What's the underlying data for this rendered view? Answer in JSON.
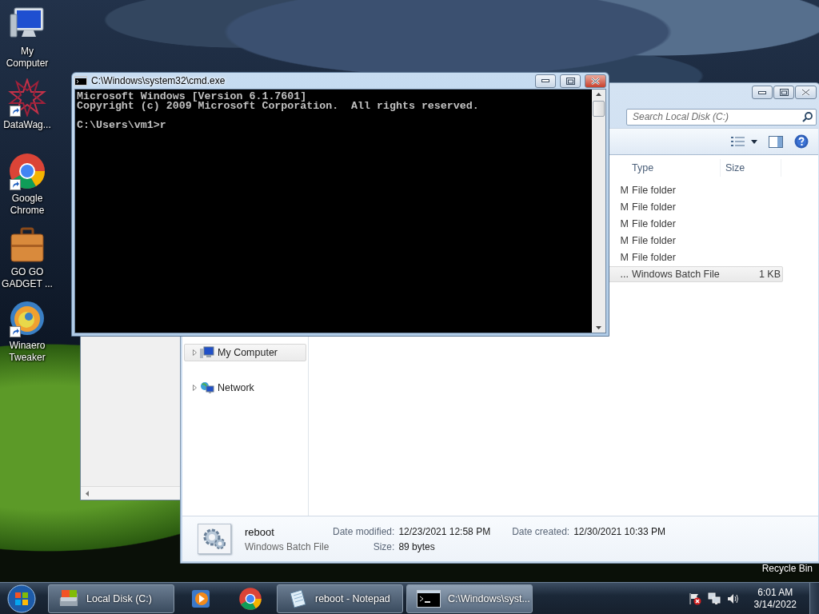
{
  "desktop_icons": [
    {
      "kind": "computer",
      "label": "My Computer",
      "shortcut": false
    },
    {
      "kind": "star",
      "label": "DataWag...",
      "shortcut": true
    },
    {
      "kind": "chrome",
      "label": "Google Chrome",
      "shortcut": true
    },
    {
      "kind": "briefcase",
      "label": "GO GO GADGET ...",
      "shortcut": false
    },
    {
      "kind": "swirl",
      "label": "Winaero Tweaker",
      "shortcut": true
    }
  ],
  "recycle_bin_label": "Recycle Bin",
  "explorer": {
    "search": {
      "placeholder": "Search Local Disk (C:)"
    },
    "columns": [
      "Type",
      "Size"
    ],
    "rows": [
      {
        "column_1": "M",
        "type": "File folder",
        "hovered": false
      },
      {
        "column_1": "M",
        "type": "File folder",
        "hovered": false
      },
      {
        "column_1": "M",
        "type": "File folder",
        "hovered": false
      },
      {
        "column_1": "M",
        "type": "File folder",
        "hovered": false
      },
      {
        "column_1": "M",
        "type": "File folder",
        "hovered": false
      },
      {
        "column_1": "...",
        "type": "Windows Batch File",
        "size": "1 KB",
        "hovered": true
      }
    ],
    "nav": [
      {
        "kind": "computer",
        "label": "My Computer",
        "hovered": true
      },
      {
        "kind": "network",
        "label": "Network",
        "hovered": false
      }
    ],
    "details": {
      "name": "reboot",
      "type": "Windows Batch File",
      "fields": [
        {
          "label": "Date modified:",
          "value": "12/23/2021 12:58 PM"
        },
        {
          "label": "Date created:",
          "value": "12/30/2021 10:33 PM"
        },
        {
          "label": "Size:",
          "value": "89 bytes"
        }
      ]
    }
  },
  "cmd_window": {
    "title": "C:\\Windows\\system32\\cmd.exe",
    "blocks": [
      {
        "lines": [
          "Microsoft Windows [Version 6.1.7601]",
          "Copyright (c) 2009 Microsoft Corporation.  All rights reserved."
        ]
      },
      {
        "lines": [
          "C:\\Users\\vm1>r"
        ]
      }
    ]
  },
  "taskbar": {
    "buttons": [
      {
        "kind": "drive",
        "label": "Local Disk (C:)",
        "open": true,
        "active": false
      },
      {
        "kind": "media",
        "open": false,
        "active": false
      },
      {
        "kind": "chrome",
        "open": false,
        "active": false
      },
      {
        "kind": "notepad",
        "label": "reboot - Notepad",
        "open": true,
        "active": false
      },
      {
        "kind": "console",
        "label": "C:\\Windows\\syst...",
        "open": true,
        "active": true
      }
    ],
    "clock": {
      "time": "6:01 AM",
      "date": "3/14/2022"
    }
  }
}
